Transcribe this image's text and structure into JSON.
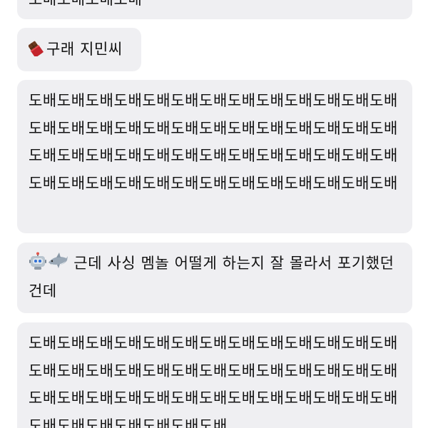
{
  "messages": [
    {
      "text": "도배도배도배도배"
    },
    {
      "emoji": [
        "chocolate-bar-icon"
      ],
      "text": "구래 지민씨"
    },
    {
      "text": "도배도배도배도배도배도배도배도배도배도배도배도배도배도배도배도배도배도배도배도배도배도배도배도배도배도배도배도배도배도배도배도배도배도배도배도배도배도배도배도배도배도배도배도배도배도배도배도배도배도배도배도배"
    },
    {
      "emoji": [
        "robot-icon",
        "shark-icon"
      ],
      "text": "근데 사싱 멤놀 어떨게 하는지 잘 몰라서 포기했던건데"
    },
    {
      "text": "도배도배도배도배도배도배도배도배도배도배도배도배도배도배도배도배도배도배도배도배도배도배도배도배도배도배도배도배도배도배도배도배도배도배도배도배도배도배도배도배도배도배도배도배도배도배"
    }
  ]
}
